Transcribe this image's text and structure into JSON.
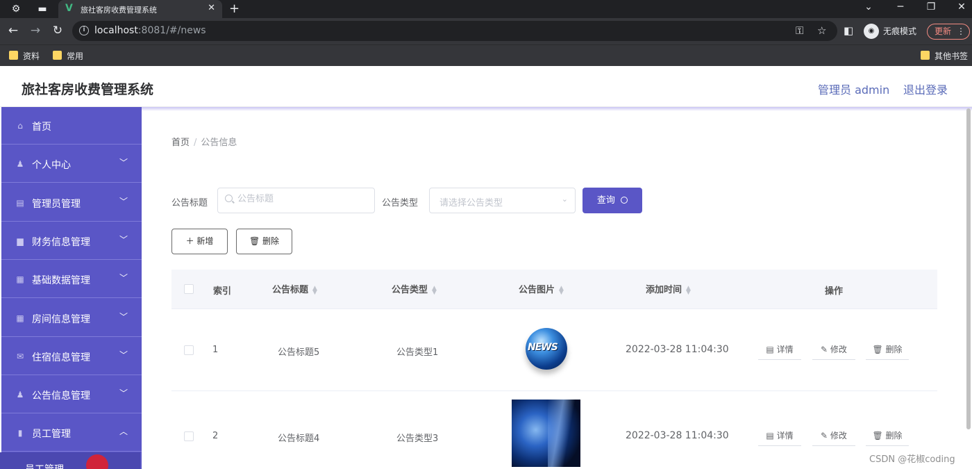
{
  "browser": {
    "tab_title": "旅社客房收费管理系统",
    "tab_favicon": "V",
    "url_host": "localhost",
    "url_rest": ":8081/#/news",
    "profile_label": "无痕模式",
    "update_label": "更新",
    "bookmarks": [
      "资料",
      "常用"
    ],
    "other_bookmarks": "其他书签"
  },
  "header": {
    "title": "旅社客房收费管理系统",
    "user": "管理员 admin",
    "logout": "退出登录"
  },
  "sidebar": {
    "items": [
      {
        "label": "首页",
        "icon": "home-icon",
        "glyph": "⌂"
      },
      {
        "label": "个人中心",
        "icon": "user-icon",
        "glyph": "♟"
      },
      {
        "label": "管理员管理",
        "icon": "briefcase-icon",
        "glyph": "▤"
      },
      {
        "label": "财务信息管理",
        "icon": "finance-icon",
        "glyph": "▆"
      },
      {
        "label": "基础数据管理",
        "icon": "clipboard-icon",
        "glyph": "▦"
      },
      {
        "label": "房间信息管理",
        "icon": "grid-icon",
        "glyph": "▦"
      },
      {
        "label": "住宿信息管理",
        "icon": "mail-icon",
        "glyph": "✉"
      },
      {
        "label": "公告信息管理",
        "icon": "user-icon",
        "glyph": "♟"
      },
      {
        "label": "员工管理",
        "icon": "bar-chart-icon",
        "glyph": "▮"
      }
    ],
    "submenu_label": "员工管理"
  },
  "breadcrumb": {
    "home": "首页",
    "separator": "/",
    "current": "公告信息"
  },
  "search": {
    "title_label": "公告标题",
    "title_placeholder": "公告标题",
    "type_label": "公告类型",
    "type_placeholder": "请选择公告类型",
    "query_label": "查询"
  },
  "actions": {
    "add_label": "新增",
    "delete_label": "删除"
  },
  "table": {
    "columns": [
      "索引",
      "公告标题",
      "公告类型",
      "公告图片",
      "添加时间",
      "操作"
    ],
    "rows": [
      {
        "index": "1",
        "title": "公告标题5",
        "type": "公告类型1",
        "time": "2022-03-28 11:04:30",
        "image_icon": "news-globe-image"
      },
      {
        "index": "2",
        "title": "公告标题4",
        "type": "公告类型3",
        "time": "2022-03-28 11:04:30",
        "image_icon": "globe-image"
      }
    ],
    "row_actions": {
      "detail": "详情",
      "edit": "修改",
      "delete": "删除"
    }
  },
  "watermark": "CSDN @花椒coding",
  "colors": {
    "accent": "#5a56c6",
    "sidebar": "#5a56c6",
    "header_link": "#5a6bb8"
  }
}
